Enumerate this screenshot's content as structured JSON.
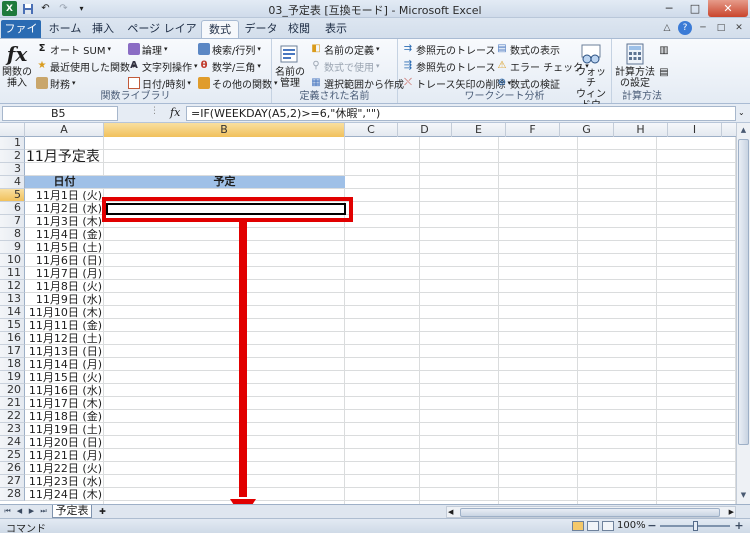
{
  "window": {
    "title": "03_予定表 [互換モード] - Microsoft Excel",
    "app_icon": "X",
    "buttons": [
      "─",
      "□",
      "✕"
    ]
  },
  "tabs": [
    {
      "label": "ファイル"
    },
    {
      "label": "ホーム"
    },
    {
      "label": "挿入"
    },
    {
      "label": "ページ レイアウト"
    },
    {
      "label": "数式",
      "active": true
    },
    {
      "label": "データ"
    },
    {
      "label": "校閲"
    },
    {
      "label": "表示"
    }
  ],
  "ribbon": {
    "function_library": {
      "label": "関数ライブラリ",
      "insert_function": "関数の\n挿入",
      "autosum": "オート SUM",
      "recent": "最近使用した関数",
      "financial": "財務",
      "logical": "論理",
      "text": "文字列操作",
      "datetime": "日付/時刻",
      "lookup": "検索/行列",
      "math": "数学/三角",
      "more": "その他の関数"
    },
    "defined_names": {
      "label": "定義された名前",
      "name_manager": "名前の\n管理",
      "define_name": "名前の定義",
      "use_in_formula": "数式で使用",
      "create_from_selection": "選択範囲から作成"
    },
    "formula_auditing": {
      "label": "ワークシート分析",
      "trace_precedents": "参照元のトレース",
      "trace_dependents": "参照先のトレース",
      "remove_arrows": "トレース矢印の削除",
      "show_formulas": "数式の表示",
      "error_checking": "エラー チェック",
      "evaluate_formula": "数式の検証",
      "watch_window": "ウォッチ\nウィンドウ"
    },
    "calculation": {
      "label": "計算方法",
      "options": "計算方法\nの設定"
    }
  },
  "formula_bar": {
    "name_box": "B5",
    "fx": "fx",
    "formula": "=IF(WEEKDAY(A5,2)>=6,\"休暇\",\"\")"
  },
  "columns": [
    "A",
    "B",
    "C",
    "D",
    "E",
    "F",
    "G",
    "H",
    "I"
  ],
  "rows": [
    "1",
    "2",
    "3",
    "4",
    "5",
    "6",
    "7",
    "8",
    "9",
    "10",
    "11",
    "12",
    "13",
    "14",
    "15",
    "16",
    "17",
    "18",
    "19",
    "20",
    "21",
    "22",
    "23",
    "24",
    "25",
    "26",
    "27",
    "28"
  ],
  "sheet": {
    "title": "11月予定表",
    "header_date": "日付",
    "header_plan": "予定",
    "dates": [
      "11月1日 (火)",
      "11月2日 (水)",
      "11月3日 (木)",
      "11月4日 (金)",
      "11月5日 (土)",
      "11月6日 (日)",
      "11月7日 (月)",
      "11月8日 (火)",
      "11月9日 (水)",
      "11月10日 (木)",
      "11月11日 (金)",
      "11月12日 (土)",
      "11月13日 (日)",
      "11月14日 (月)",
      "11月15日 (火)",
      "11月16日 (水)",
      "11月17日 (木)",
      "11月18日 (金)",
      "11月19日 (土)",
      "11月20日 (日)",
      "11月21日 (月)",
      "11月22日 (火)",
      "11月23日 (水)",
      "11月24日 (木)"
    ]
  },
  "sheet_tabs": {
    "active": "予定表"
  },
  "status_bar": {
    "mode": "コマンド",
    "zoom": "100%"
  },
  "colors": {
    "annotation": "#e10000",
    "header_fill": "#9fc0e7",
    "selected_header": "#f1c15c"
  }
}
